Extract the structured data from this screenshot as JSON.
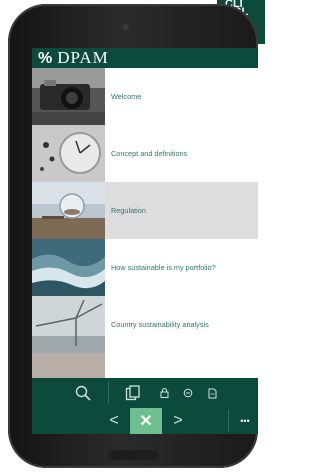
{
  "corner_text": [
    "CLI",
    "OBL",
    "RV"
  ],
  "app": {
    "logo_mark": "%",
    "logo_text": "DPAM"
  },
  "menu": {
    "items": [
      {
        "label": "Welcome",
        "image": "camera-photo"
      },
      {
        "label": "Concept and definitions",
        "image": "clock-photo"
      },
      {
        "label": "Regulation",
        "image": "glass-sphere-photo",
        "selected": true
      },
      {
        "label": "How sustainable is my portfolio?",
        "image": "ocean-waves-photo"
      },
      {
        "label": "Country sustainability analysis",
        "image": "wind-turbine-photo"
      }
    ]
  },
  "toolbar": {
    "icons": [
      "search-icon",
      "copy-icon",
      "lock-icon",
      "bookmark-icon",
      "document-icon"
    ],
    "nav": {
      "prev": "<",
      "close": "✕",
      "next": ">",
      "more": "•••"
    }
  },
  "colors": {
    "brand": "#0c4a3c",
    "link_text": "#2f7a66",
    "close_button": "#6fbf8e",
    "selected_row": "#dddddd"
  }
}
